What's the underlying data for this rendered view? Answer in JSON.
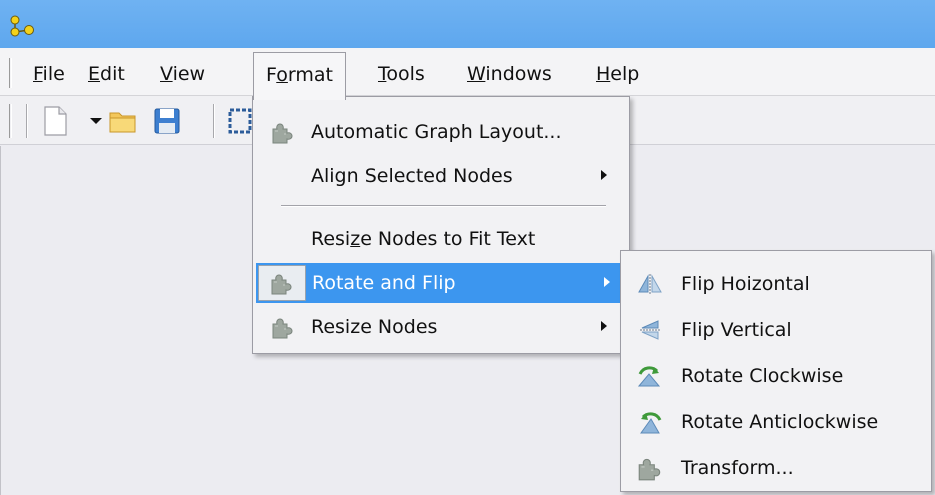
{
  "menubar": {
    "file": "File",
    "edit": "Edit",
    "view": "View",
    "format": "Format",
    "tools": "Tools",
    "windows": "Windows",
    "help": "Help"
  },
  "format_menu": {
    "automatic_graph_layout": "Automatic Graph Layout...",
    "align_selected_nodes": "Align Selected Nodes",
    "resize_nodes_to_fit_text": "Resize Nodes to Fit Text",
    "rotate_and_flip": "Rotate and Flip",
    "resize_nodes": "Resize Nodes"
  },
  "rotate_flip_submenu": {
    "flip_horizontal": "Flip Hoizontal",
    "flip_vertical": "Flip Vertical",
    "rotate_clockwise": "Rotate Clockwise",
    "rotate_anticlockwise": "Rotate Anticlockwise",
    "transform": "Transform..."
  },
  "colors": {
    "titlebar": "#5ea7ee",
    "highlight": "#3c96ef",
    "menu_bg": "#f2f2f4"
  },
  "icons": {
    "app": "graph-nodes-icon",
    "new": "new-document-icon",
    "open": "folder-open-icon",
    "save": "floppy-save-icon",
    "plugin": "puzzle-icon",
    "flip_h": "flip-horizontal-icon",
    "flip_v": "flip-vertical-icon",
    "rot_cw": "rotate-clockwise-icon",
    "rot_acw": "rotate-anticlockwise-icon"
  }
}
